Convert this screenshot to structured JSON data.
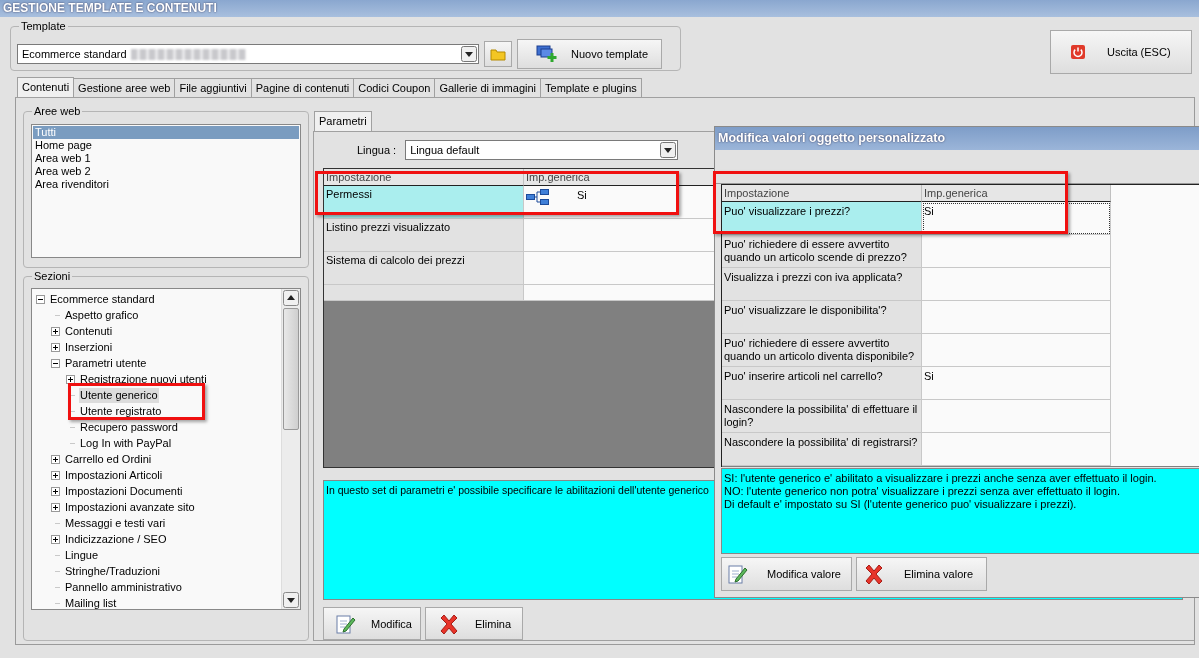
{
  "window": {
    "title": "GESTIONE TEMPLATE E CONTENUTI"
  },
  "template": {
    "label": "Template",
    "value": "Ecommerce standard",
    "new_button": "Nuovo template"
  },
  "exit_button": "Uscita (ESC)",
  "tabs": [
    {
      "label": "Contenuti",
      "selected": true
    },
    {
      "label": "Gestione aree web",
      "selected": false
    },
    {
      "label": "File aggiuntivi",
      "selected": false
    },
    {
      "label": "Pagine di contenuti",
      "selected": false
    },
    {
      "label": "Codici Coupon",
      "selected": false
    },
    {
      "label": "Gallerie di immagini",
      "selected": false
    },
    {
      "label": "Template e plugins",
      "selected": false
    }
  ],
  "web_areas": {
    "label": "Aree web",
    "items": [
      {
        "label": "Tutti",
        "selected": true
      },
      {
        "label": "Home page",
        "selected": false
      },
      {
        "label": "Area web 1",
        "selected": false
      },
      {
        "label": "Area web 2",
        "selected": false
      },
      {
        "label": "Area rivenditori",
        "selected": false
      }
    ]
  },
  "sections": {
    "label": "Sezioni",
    "items": [
      {
        "label": "Ecommerce standard",
        "kind": "folder",
        "expanded": true,
        "selected": false,
        "children": [
          {
            "label": "Aspetto grafico",
            "kind": "leaf",
            "selected": false
          },
          {
            "label": "Contenuti",
            "kind": "folder",
            "expanded": false,
            "selected": false
          },
          {
            "label": "Inserzioni",
            "kind": "folder",
            "expanded": false,
            "selected": false
          },
          {
            "label": "Parametri utente",
            "kind": "folder",
            "expanded": true,
            "selected": false,
            "children": [
              {
                "label": "Registrazione nuovi utenti",
                "kind": "folder",
                "expanded": false,
                "selected": false
              },
              {
                "label": "Utente generico",
                "kind": "leaf",
                "selected": true
              },
              {
                "label": "Utente registrato",
                "kind": "leaf",
                "selected": false
              },
              {
                "label": "Recupero password",
                "kind": "leaf",
                "selected": false
              },
              {
                "label": "Log In with PayPal",
                "kind": "leaf",
                "selected": false
              }
            ]
          },
          {
            "label": "Carrello ed Ordini",
            "kind": "folder",
            "expanded": false,
            "selected": false
          },
          {
            "label": "Impostazioni Articoli",
            "kind": "folder",
            "expanded": false,
            "selected": false
          },
          {
            "label": "Impostazioni Documenti",
            "kind": "folder",
            "expanded": false,
            "selected": false
          },
          {
            "label": "Impostazioni avanzate sito",
            "kind": "folder",
            "expanded": false,
            "selected": false
          },
          {
            "label": "Messaggi e testi vari",
            "kind": "leaf",
            "selected": false
          },
          {
            "label": "Indicizzazione / SEO",
            "kind": "folder",
            "expanded": false,
            "selected": false
          },
          {
            "label": "Lingue",
            "kind": "leaf",
            "selected": false
          },
          {
            "label": "Stringhe/Traduzioni",
            "kind": "leaf",
            "selected": false
          },
          {
            "label": "Pannello amministrativo",
            "kind": "leaf",
            "selected": false
          },
          {
            "label": "Mailing list",
            "kind": "leaf",
            "selected": false
          }
        ]
      }
    ]
  },
  "parameters": {
    "tab": "Parametri",
    "language_label": "Lingua :",
    "language": "Lingua default",
    "columns": [
      "Impostazione",
      "Imp.generica"
    ],
    "rows": [
      {
        "setting": "Permessi",
        "value": "Si",
        "kind": "group",
        "selected": true
      },
      {
        "setting": "Listino prezzi visualizzato",
        "kind": "setting",
        "selected": false
      },
      {
        "setting": "Sistema di calcolo dei prezzi",
        "kind": "setting",
        "selected": false
      }
    ],
    "description": "In questo set di parametri e' possibile specificare le abilitazioni dell'utente generico",
    "buttons": [
      {
        "label": "Modifica",
        "kind": "edit"
      },
      {
        "label": "Elimina",
        "kind": "delete"
      }
    ]
  },
  "dialog": {
    "title": "Modifica valori oggetto personalizzato",
    "columns": [
      "Impostazione",
      "Imp.generica"
    ],
    "rows": [
      {
        "setting": "Puo' visualizzare i prezzi?",
        "value": "Si",
        "selected": true
      },
      {
        "setting": "Puo' richiedere di essere avvertito quando un articolo scende di prezzo?",
        "selected": false
      },
      {
        "setting": "Visualizza i prezzi con iva applicata?",
        "selected": false
      },
      {
        "setting": "Puo' visualizzare le disponibilita'?",
        "selected": false
      },
      {
        "setting": "Puo' richiedere di essere avvertito quando un articolo diventa disponibile?",
        "selected": false
      },
      {
        "setting": "Puo' inserire articoli nel carrello?",
        "value": "Si",
        "selected": false
      },
      {
        "setting": "Nascondere la possibilita' di effettuare il login?",
        "selected": false
      },
      {
        "setting": "Nascondere la possibilita' di registrarsi?",
        "selected": false
      }
    ],
    "description": [
      "SI: l'utente generico e' abilitato a visualizzare i prezzi anche senza aver effettuato il login.",
      "NO: l'utente generico non potra' visualizzare i prezzi senza aver effettuato il login.",
      "Di default e' impostato su SI (l'utente generico puo' visualizzare i prezzi)."
    ],
    "buttons": [
      {
        "label": "Modifica valore",
        "kind": "edit"
      },
      {
        "label": "Elimina valore",
        "kind": "delete"
      }
    ]
  }
}
